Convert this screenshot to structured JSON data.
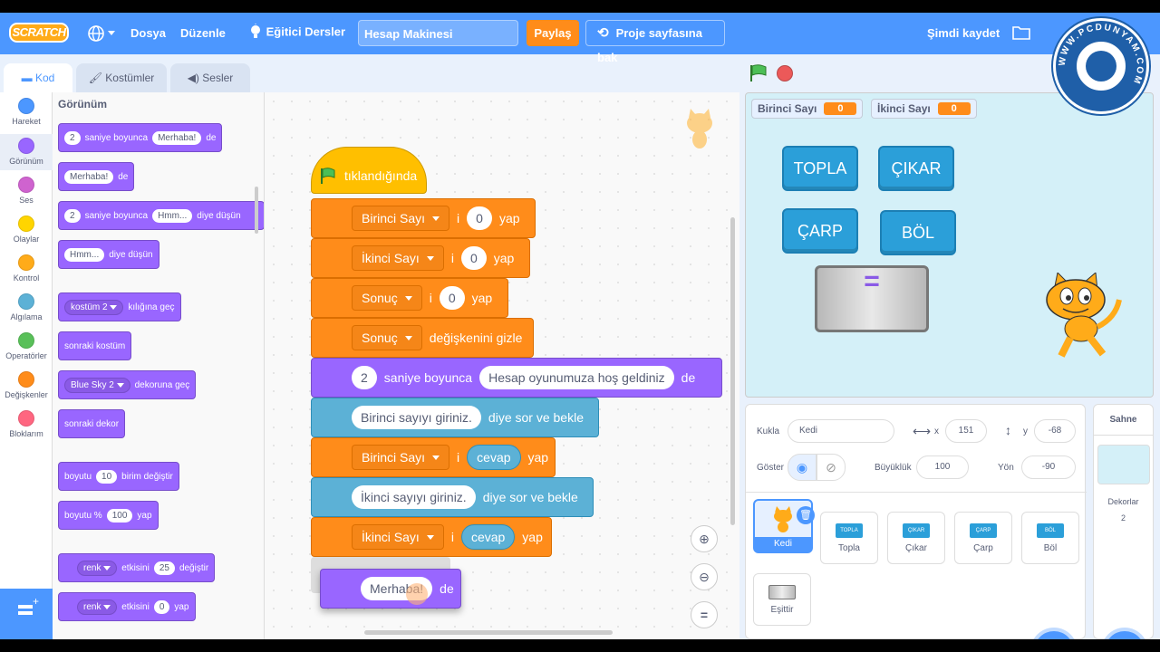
{
  "menubar": {
    "logo": "SCRATCH",
    "file": "Dosya",
    "edit": "Düzenle",
    "tutorials": "Eğitici Dersler",
    "project_title": "Hesap Makinesi",
    "share": "Paylaş",
    "see_project": "Proje sayfasına bak",
    "save_now": "Şimdi kaydet"
  },
  "watermark": "WWW.PCDUNYAM.COM",
  "tabs": {
    "code": "Kod",
    "costumes": "Kostümler",
    "sounds": "Sesler"
  },
  "categories": [
    {
      "label": "Hareket",
      "color": "#4c97ff"
    },
    {
      "label": "Görünüm",
      "color": "#9966ff"
    },
    {
      "label": "Ses",
      "color": "#cf63cf"
    },
    {
      "label": "Olaylar",
      "color": "#ffd500"
    },
    {
      "label": "Kontrol",
      "color": "#ffab19"
    },
    {
      "label": "Algılama",
      "color": "#5cb1d6"
    },
    {
      "label": "Operatörler",
      "color": "#59c059"
    },
    {
      "label": "Değişkenler",
      "color": "#ff8c1a"
    },
    {
      "label": "Bloklarım",
      "color": "#ff6680"
    }
  ],
  "palette": {
    "heading": "Görünüm",
    "b1": {
      "n": "2",
      "t1": "saniye boyunca",
      "in": "Merhaba!",
      "t2": "de"
    },
    "b2": {
      "in": "Merhaba!",
      "t": "de"
    },
    "b3": {
      "n": "2",
      "t1": "saniye boyunca",
      "in": "Hmm...",
      "t2": "diye düşün"
    },
    "b4": {
      "in": "Hmm...",
      "t": "diye düşün"
    },
    "b5": {
      "dd": "kostüm 2",
      "t": "kılığına geç"
    },
    "b6": "sonraki kostüm",
    "b7": {
      "dd": "Blue Sky 2",
      "t": "dekoruna geç"
    },
    "b8": "sonraki dekor",
    "b9": {
      "t1": "boyutu",
      "n": "10",
      "t2": "birim değiştir"
    },
    "b10": {
      "t1": "boyutu %",
      "n": "100",
      "t2": "yap"
    },
    "b11": {
      "dd": "renk",
      "t1": "etkisini",
      "n": "25",
      "t2": "değiştir"
    },
    "b12": {
      "dd": "renk",
      "t1": "etkisini",
      "n": "0",
      "t2": "yap"
    }
  },
  "script": {
    "hat": "tıklandığında",
    "s1": {
      "var": "Birinci Sayı",
      "t": "i",
      "val": "0",
      "t2": "yap"
    },
    "s2": {
      "var": "İkinci Sayı",
      "t": "i",
      "val": "0",
      "t2": "yap"
    },
    "s3": {
      "var": "Sonuç",
      "t": "i",
      "val": "0",
      "t2": "yap"
    },
    "s4": {
      "var": "Sonuç",
      "t": "değişkenini gizle"
    },
    "s5": {
      "n": "2",
      "t1": "saniye boyunca",
      "in": "Hesap oyunumuza hoş geldiniz",
      "t2": "de"
    },
    "s6": {
      "in": "Birinci sayıyı giriniz.",
      "t": "diye sor ve bekle"
    },
    "s7": {
      "var": "Birinci Sayı",
      "t": "i",
      "rep": "cevap",
      "t2": "yap"
    },
    "s8": {
      "in": "İkinci sayıyı giriniz.",
      "t": "diye sor ve bekle"
    },
    "s9": {
      "var": "İkinci Sayı",
      "t": "i",
      "rep": "cevap",
      "t2": "yap"
    },
    "drag": {
      "in": "Merhaba!",
      "t": "de"
    },
    "zoom_reset": "="
  },
  "stage": {
    "monitors": [
      {
        "label": "Birinci Sayı",
        "value": "0"
      },
      {
        "label": "İkinci Sayı",
        "value": "0"
      }
    ],
    "buttons": {
      "add": "TOPLA",
      "sub": "ÇIKAR",
      "mul": "ÇARP",
      "div": "BÖL",
      "eq": "="
    }
  },
  "sprite_info": {
    "sprite_label": "Kukla",
    "sprite_name": "Kedi",
    "x_label": "x",
    "x": "151",
    "y_label": "y",
    "y": "-68",
    "show_label": "Göster",
    "size_label": "Büyüklük",
    "size": "100",
    "dir_label": "Yön",
    "dir": "-90"
  },
  "sprites": [
    {
      "name": "Kedi",
      "thumb": ""
    },
    {
      "name": "Topla",
      "thumb": "TOPLA"
    },
    {
      "name": "Çıkar",
      "thumb": "ÇIKAR"
    },
    {
      "name": "Çarp",
      "thumb": "ÇARP"
    },
    {
      "name": "Böl",
      "thumb": "BÖL"
    },
    {
      "name": "Eşittir",
      "thumb": ""
    }
  ],
  "stage_pane": {
    "title": "Sahne",
    "backdrops_label": "Dekorlar",
    "backdrops_count": "2"
  }
}
